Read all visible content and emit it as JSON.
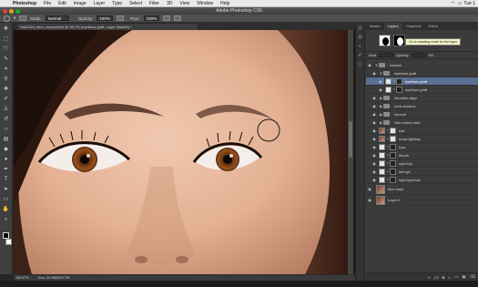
{
  "menubar": {
    "items": [
      "Photoshop",
      "File",
      "Edit",
      "Image",
      "Layer",
      "Type",
      "Select",
      "Filter",
      "3D",
      "View",
      "Window",
      "Help"
    ],
    "clock": "Tue 1"
  },
  "window": {
    "title": "Adobe Photoshop CS6"
  },
  "options": {
    "mode_label": "Mode:",
    "mode_value": "Normal",
    "opacity_label": "Opacity:",
    "opacity_value": "100%",
    "flow_label": "Flow:",
    "flow_value": "100%"
  },
  "document": {
    "tab": "Hair1154_face_composit.tif @ 66.7% (eyebrow graft, Layer Mask/8) *",
    "zoom": "66.67%",
    "doc_size": "Doc: 24.9M/302.7M"
  },
  "panel": {
    "tabs": [
      "Masks",
      "Layers",
      "Channels",
      "Paths"
    ],
    "tooltip": "Go to masking mode for the layer",
    "opts_row": {
      "kind": "Kind",
      "opacity": "Opacity",
      "fill": "Fill"
    },
    "layers": [
      {
        "name": "retouch",
        "type": "folder",
        "tri": "▼"
      },
      {
        "name": "eyebrow graft",
        "type": "folder",
        "tri": "▼"
      },
      {
        "name": "eyebrow graft",
        "type": "masked",
        "selected": true
      },
      {
        "name": "eyebrow graft",
        "type": "masked"
      },
      {
        "name": "shoulder align",
        "type": "folder",
        "tri": "▶"
      },
      {
        "name": "neck shadow",
        "type": "folder",
        "tri": "▶"
      },
      {
        "name": "smooth",
        "type": "folder",
        "tri": "▶"
      },
      {
        "name": "Skin colour cast",
        "type": "folder",
        "tri": "▶"
      },
      {
        "name": "hair",
        "type": "face"
      },
      {
        "name": "cross lighting",
        "type": "face"
      },
      {
        "name": "Lips",
        "type": "masked"
      },
      {
        "name": "Mouth",
        "type": "masked"
      },
      {
        "name": "right eye",
        "type": "masked"
      },
      {
        "name": "left eye",
        "type": "masked"
      },
      {
        "name": "right eyebrow",
        "type": "masked"
      },
      {
        "name": "face base",
        "type": "face",
        "big": true
      },
      {
        "name": "Layer 0",
        "type": "face",
        "big": true
      }
    ]
  }
}
